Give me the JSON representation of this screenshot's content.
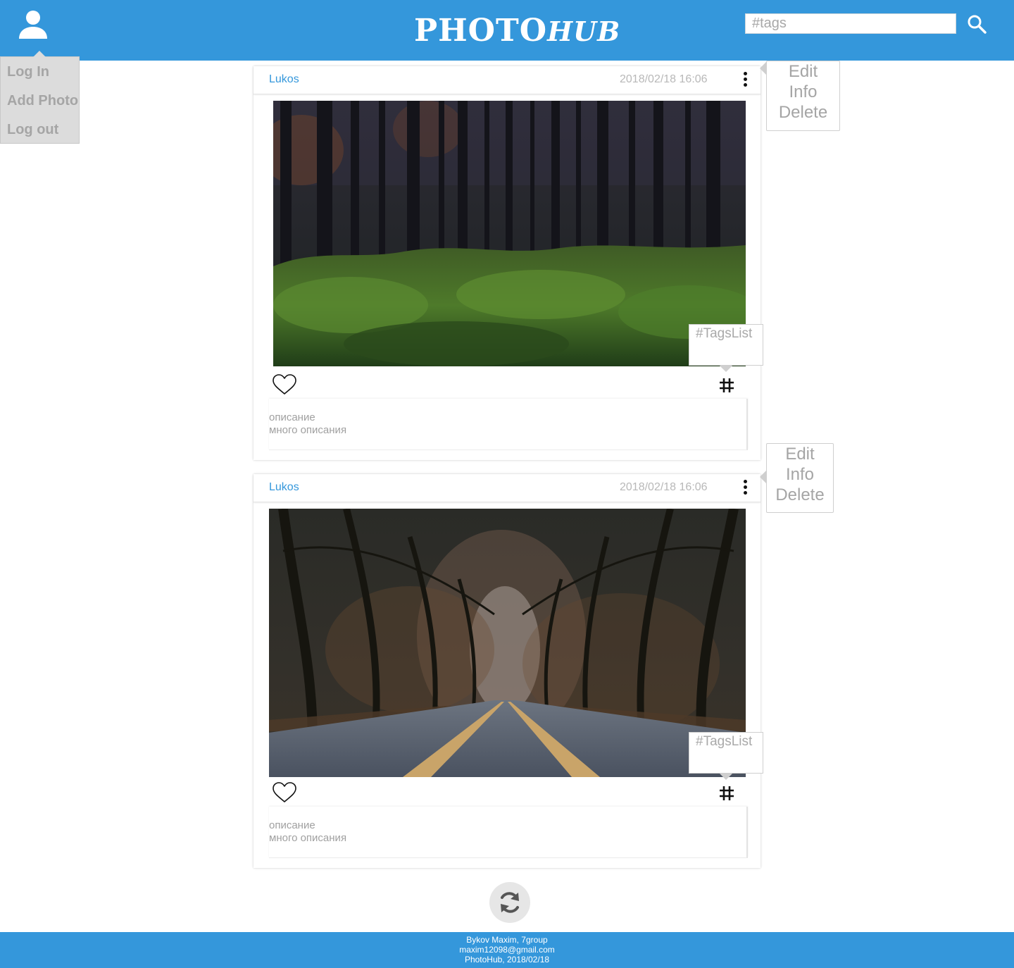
{
  "header": {
    "logo_main": "PHOTO",
    "logo_accent": "HUB",
    "search_placeholder": "#tags"
  },
  "user_menu": {
    "items": [
      {
        "label": "Log In"
      },
      {
        "label": "Add Photo"
      },
      {
        "label": "Log out"
      }
    ]
  },
  "posts": [
    {
      "author": "Lukos",
      "date": "2018/02/18 16:06",
      "description": [
        "описание",
        "много описания"
      ],
      "tags_label": "#TagsList",
      "menu": [
        "Edit",
        "Info",
        "Delete"
      ]
    },
    {
      "author": "Lukos",
      "date": "2018/02/18 16:06",
      "description": [
        "описание",
        "много описания"
      ],
      "tags_label": "#TagsList",
      "menu": [
        "Edit",
        "Info",
        "Delete"
      ]
    }
  ],
  "footer": {
    "lines": [
      "Bykov Maxim, 7group",
      "maxim12098@gmail.com",
      "PhotoHub, 2018/02/18"
    ]
  },
  "colors": {
    "primary": "#3497db",
    "muted_text": "#a5a5a5"
  },
  "icons": [
    "user-icon",
    "search-icon",
    "kebab-menu-icon",
    "heart-icon",
    "hashtag-icon",
    "refresh-icon"
  ]
}
